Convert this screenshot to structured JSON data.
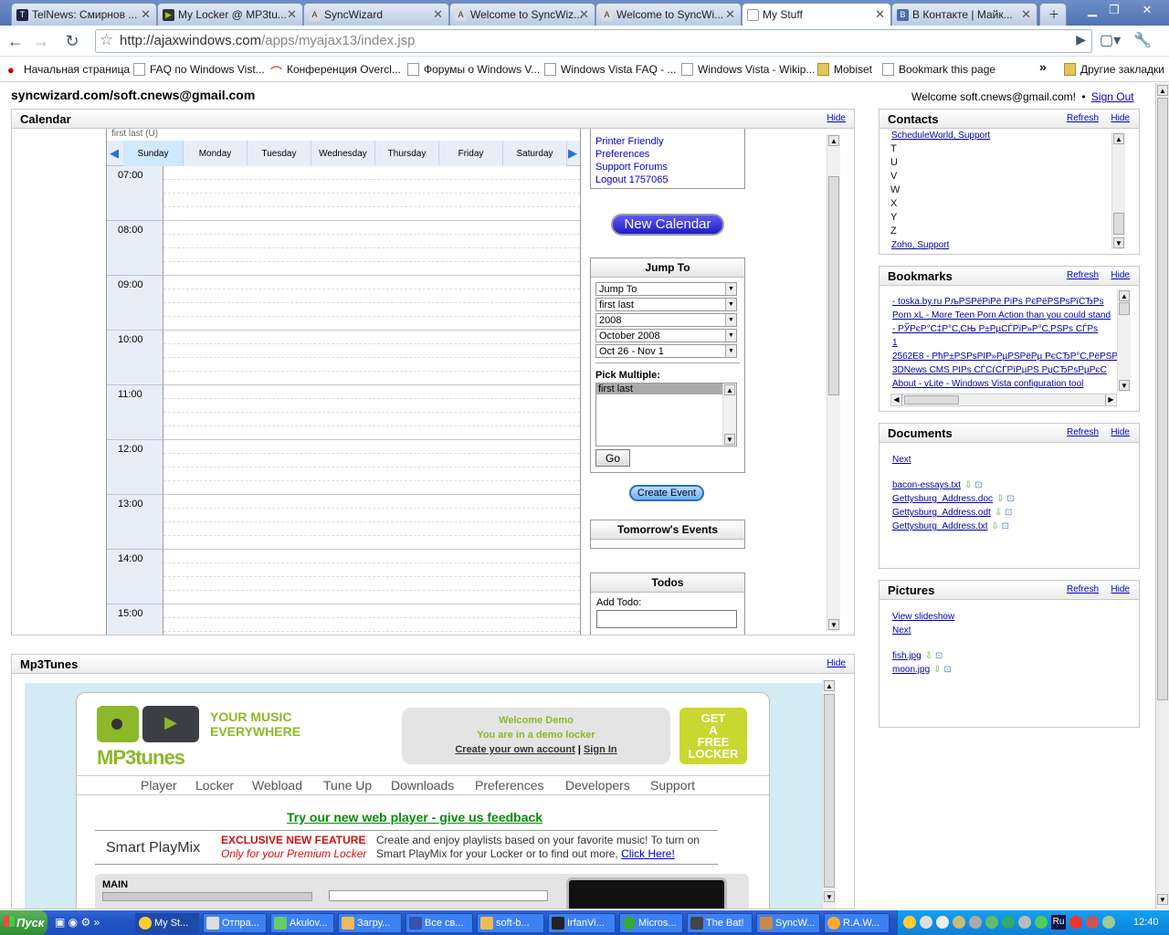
{
  "browser": {
    "tabs": [
      {
        "label": "TelNews: Смирнов ...",
        "icon": "telnews-favicon"
      },
      {
        "label": "My Locker @ MP3tu...",
        "icon": "mp3tunes-favicon"
      },
      {
        "label": "SyncWizard",
        "icon": "ajax13-favicon"
      },
      {
        "label": "Welcome to SyncWiz...",
        "icon": "ajax13-favicon"
      },
      {
        "label": "Welcome to SyncWi...",
        "icon": "ajax13-favicon"
      },
      {
        "label": "My Stuff",
        "icon": "page-favicon"
      },
      {
        "label": "В Контакте | Майк...",
        "icon": "vk-favicon"
      }
    ],
    "url_host": "http://ajaxwindows.com",
    "url_path": "/apps/myajax13/index.jsp",
    "bookmarks": [
      "Начальная страница",
      "FAQ по Windows Vist...",
      "Конференция Overcl...",
      "Форумы о Windows V...",
      "Windows Vista FAQ - ...",
      "Windows Vista - Wikip...",
      "Mobiset",
      "Bookmark this page"
    ],
    "other_bookmarks": "Другие закладки",
    "overflow": "»"
  },
  "header": {
    "account": "syncwizard.com/soft.cnews@gmail.com",
    "welcome": "Welcome soft.cnews@gmail.com!",
    "bullet": "•",
    "sign_out": "Sign Out"
  },
  "calendar": {
    "title": "Calendar",
    "hide": "Hide",
    "owner": "first last (U)",
    "days": [
      "Sunday",
      "Monday",
      "Tuesday",
      "Wednesday",
      "Thursday",
      "Friday",
      "Saturday"
    ],
    "hours": [
      "07:00",
      "08:00",
      "09:00",
      "10:00",
      "11:00",
      "12:00",
      "13:00",
      "14:00",
      "15:00"
    ],
    "menu_links": [
      "Printer Friendly",
      "Preferences",
      "Support Forums",
      "Logout 1757065"
    ],
    "new_calendar": "New Calendar",
    "jump_to": {
      "title": "Jump To",
      "selects": [
        "Jump To",
        "first last",
        "2008",
        "October 2008",
        "Oct 26 - Nov 1"
      ],
      "pick_multiple_label": "Pick Multiple:",
      "pick_multiple_option": "first last",
      "go": "Go"
    },
    "create_event": "Create Event",
    "tomorrows_events": "Tomorrow's Events",
    "todos": {
      "title": "Todos",
      "add_label": "Add Todo:"
    }
  },
  "contacts": {
    "title": "Contacts",
    "refresh": "Refresh",
    "hide": "Hide",
    "items": [
      "ScheduleWorld, Support",
      "T",
      "U",
      "V",
      "W",
      "X",
      "Y",
      "Z",
      "Zoho, Support"
    ]
  },
  "bookmarks_panel": {
    "title": "Bookmarks",
    "refresh": "Refresh",
    "hide": "Hide",
    "items": [
      "- toska.by.ru РљРЅРёРіРё РіРѕ РєРёРЅРѕРїСЂРѕ",
      "Porn xL - More Teen Porn Action than you could stand",
      "- РЎРєР°С‡Р°С‚СЊ Р±РµСЃРїР»Р°С‚РЅРѕ СЃРѕ",
      "1",
      "2562E8 - РћР±РЅРѕРІР»РµРЅРёРµ РєСЂР°С‚РёРЅРѕ",
      "3DNews CMS РІРѕ СЃСѓСЃРїРµРЅ РџСЂРѕРµРєС",
      "About - vLite - Windows Vista configuration tool"
    ]
  },
  "documents": {
    "title": "Documents",
    "refresh": "Refresh",
    "hide": "Hide",
    "next": "Next",
    "files": [
      "bacon-essays.txt",
      "Gettysburg_Address.doc",
      "Gettysburg_Address.odt",
      "Gettysburg_Address.txt"
    ]
  },
  "pictures": {
    "title": "Pictures",
    "refresh": "Refresh",
    "hide": "Hide",
    "slideshow": "View slideshow",
    "next": "Next",
    "files": [
      "fish.jpg",
      "moon.jpg"
    ]
  },
  "mp3tunes": {
    "title": "Mp3Tunes",
    "hide": "Hide",
    "logo_text": "MP3tunes",
    "tagline_1": "YOUR MUSIC",
    "tagline_2": "EVERYWHERE",
    "welcome": "Welcome Demo",
    "demo_locker": "You are in a demo locker",
    "create_account": "Create your own account",
    "divider": "|",
    "sign_in": "Sign In",
    "get_locker": [
      "GET",
      "A",
      "FREE",
      "LOCKER"
    ],
    "nav": [
      "Player",
      "Locker",
      "Webload",
      "Tune Up",
      "Downloads",
      "Preferences",
      "Developers",
      "Support"
    ],
    "feedback": "Try our new web player - give us feedback",
    "smart_playmix": "Smart PlayMix",
    "exclusive": "EXCLUSIVE NEW FEATURE",
    "premium": "Only for your Premium Locker",
    "promo_1": "Create and enjoy playlists based on your favorite music! To turn on",
    "promo_2": "Smart PlayMix for your Locker or to find out more,",
    "click_here": "Click Here!",
    "main_label": "MAIN"
  },
  "taskbar": {
    "start": "Пуск",
    "buttons": [
      "My St...",
      "Отпра...",
      "Akulov...",
      "Загру...",
      "Все св...",
      "soft-b...",
      "IrfanVi...",
      "Micros...",
      "The Bat!",
      "SyncW...",
      "R.A.W..."
    ],
    "lang": "Ru",
    "clock": "12:40"
  },
  "colors": {
    "accent_blue": "#2a2ad8",
    "mp3_green": "#8cb829",
    "mp3_blue": "#3aa0d8",
    "exclusive_red": "#d01010",
    "feedback_green": "#0a8a0a"
  }
}
